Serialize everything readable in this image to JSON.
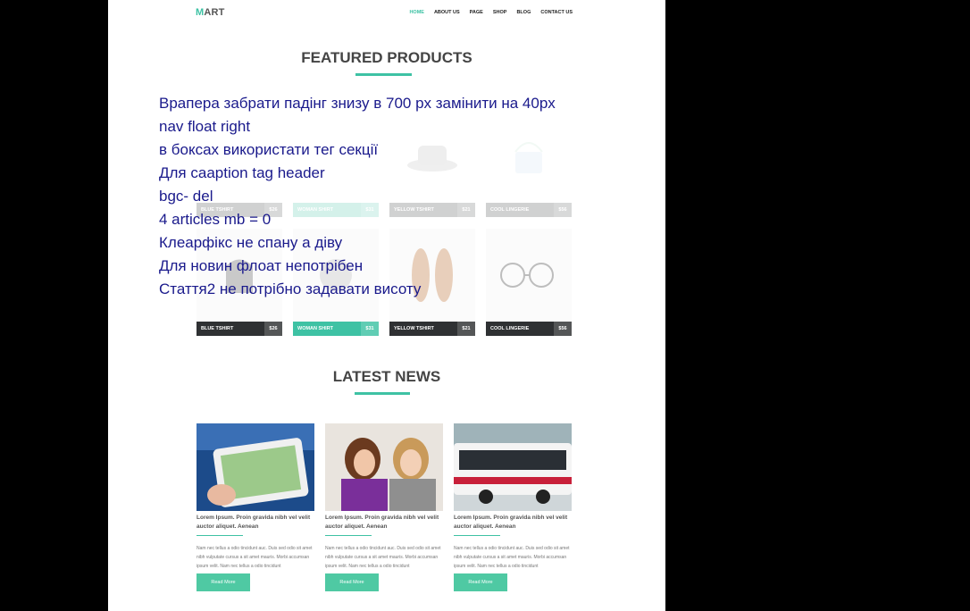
{
  "logo": {
    "first": "M",
    "rest": "ART"
  },
  "nav": [
    "HOME",
    "ABOUT US",
    "PAGE",
    "SHOP",
    "BLOG",
    "CONTACT US"
  ],
  "featured": {
    "title": "FEATURED PRODUCTS",
    "row1": [
      {
        "name": "BLUE TSHIRT",
        "price": "$26"
      },
      {
        "name": "WOMAN SHIRT",
        "price": "$31"
      },
      {
        "name": "YELLOW TSHIRT",
        "price": "$21"
      },
      {
        "name": "COOL LINGERIE",
        "price": "$56"
      }
    ],
    "row2": [
      {
        "name": "BLUE TSHIRT",
        "price": "$26"
      },
      {
        "name": "WOMAN SHIRT",
        "price": "$31"
      },
      {
        "name": "YELLOW TSHIRT",
        "price": "$21"
      },
      {
        "name": "COOL LINGERIE",
        "price": "$56"
      }
    ]
  },
  "news": {
    "title": "LATEST NEWS",
    "items": [
      {
        "headline": "Lorem Ipsum. Proin gravida nibh vel velit auctor aliquet. Aenean",
        "body": "Nam nec tellus a odio tincidunt auc. Duis sed odio sit amet nibh vulputate cursus a sit amet mauris. Morbi accumsan ipsum velit. Nam nec tellus a odio tincidunt",
        "button": "Read More"
      },
      {
        "headline": "Lorem Ipsum. Proin gravida nibh vel velit auctor aliquet. Aenean",
        "body": "Nam nec tellus a odio tincidunt auc. Duis sed odio sit amet nibh vulputate cursus a sit amet mauris. Morbi accumsan ipsum velit. Nam nec tellus a odio tincidunt",
        "button": "Read More"
      },
      {
        "headline": "Lorem Ipsum. Proin gravida nibh vel velit auctor aliquet. Aenean",
        "body": "Nam nec tellus a odio tincidunt auc. Duis sed odio sit amet nibh vulputate cursus a sit amet mauris. Morbi accumsan ipsum velit. Nam nec tellus a odio tincidunt",
        "button": "Read More"
      }
    ]
  },
  "notes": [
    "Врапера забрати падінг знизу в 700 px замінити на 40px",
    "nav float right",
    "в боксах використати тег секції",
    "Для caaption tag header",
    "bgc- del",
    "4 articles mb = 0",
    "Клеарфікс не спану а діву",
    "Для новин флоат непотрібен",
    "Стаття2 не потрібно задавати висоту"
  ],
  "colors": {
    "accent": "#3ec2a4",
    "dark_bar": "#2f3133",
    "note_text": "#1a1a8c"
  }
}
